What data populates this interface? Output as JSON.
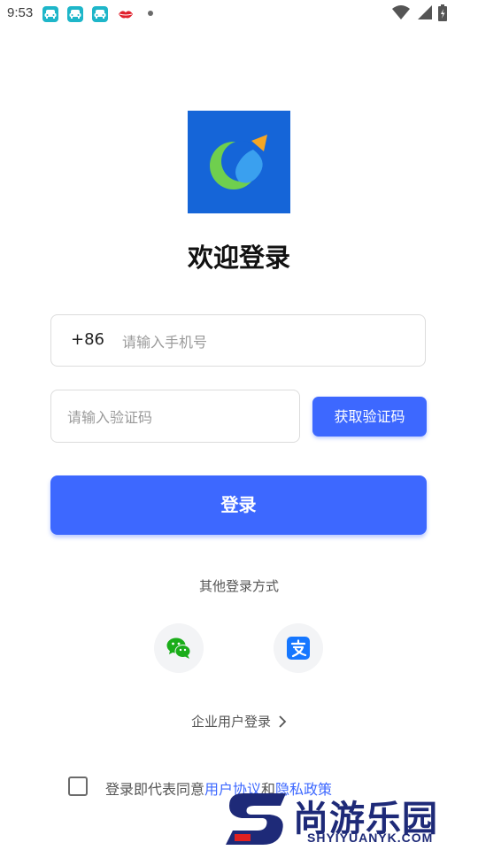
{
  "status_bar": {
    "time": "9:53",
    "notification_icons": [
      "car-app-icon",
      "car-app-icon",
      "car-app-icon",
      "lips-app-icon",
      "more-dot-icon"
    ],
    "system_icons": [
      "wifi-icon",
      "signal-icon",
      "battery-icon"
    ]
  },
  "app": {
    "logo_icon": "app-logo-icon",
    "welcome_title": "欢迎登录",
    "brand_colors": {
      "logo_bg": "#1565d8",
      "accent": "#3d68ff"
    }
  },
  "form": {
    "phone_prefix": "+86",
    "phone_placeholder": "请输入手机号",
    "phone_value": "",
    "code_placeholder": "请输入验证码",
    "code_value": "",
    "get_code_label": "获取验证码",
    "login_label": "登录"
  },
  "other_login": {
    "label": "其他登录方式",
    "methods": [
      {
        "name": "wechat",
        "icon": "wechat-icon"
      },
      {
        "name": "alipay",
        "icon": "alipay-icon"
      }
    ]
  },
  "enterprise_login_label": "企业用户登录",
  "agreement": {
    "checked": false,
    "prefix": "登录即代表同意",
    "user_agreement": "用户协议",
    "conjunction": "和",
    "privacy_policy": "隐私政策"
  },
  "watermark": {
    "title": "尚游乐园",
    "subtitle": "SHYIYUANYK.COM"
  }
}
